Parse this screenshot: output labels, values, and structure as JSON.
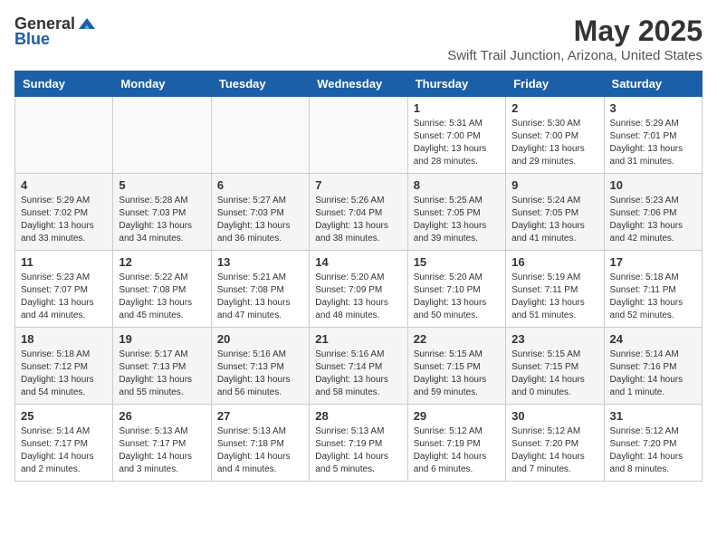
{
  "header": {
    "logo_general": "General",
    "logo_blue": "Blue",
    "month_title": "May 2025",
    "location": "Swift Trail Junction, Arizona, United States"
  },
  "weekdays": [
    "Sunday",
    "Monday",
    "Tuesday",
    "Wednesday",
    "Thursday",
    "Friday",
    "Saturday"
  ],
  "weeks": [
    [
      {
        "day": "",
        "info": ""
      },
      {
        "day": "",
        "info": ""
      },
      {
        "day": "",
        "info": ""
      },
      {
        "day": "",
        "info": ""
      },
      {
        "day": "1",
        "info": "Sunrise: 5:31 AM\nSunset: 7:00 PM\nDaylight: 13 hours\nand 28 minutes."
      },
      {
        "day": "2",
        "info": "Sunrise: 5:30 AM\nSunset: 7:00 PM\nDaylight: 13 hours\nand 29 minutes."
      },
      {
        "day": "3",
        "info": "Sunrise: 5:29 AM\nSunset: 7:01 PM\nDaylight: 13 hours\nand 31 minutes."
      }
    ],
    [
      {
        "day": "4",
        "info": "Sunrise: 5:29 AM\nSunset: 7:02 PM\nDaylight: 13 hours\nand 33 minutes."
      },
      {
        "day": "5",
        "info": "Sunrise: 5:28 AM\nSunset: 7:03 PM\nDaylight: 13 hours\nand 34 minutes."
      },
      {
        "day": "6",
        "info": "Sunrise: 5:27 AM\nSunset: 7:03 PM\nDaylight: 13 hours\nand 36 minutes."
      },
      {
        "day": "7",
        "info": "Sunrise: 5:26 AM\nSunset: 7:04 PM\nDaylight: 13 hours\nand 38 minutes."
      },
      {
        "day": "8",
        "info": "Sunrise: 5:25 AM\nSunset: 7:05 PM\nDaylight: 13 hours\nand 39 minutes."
      },
      {
        "day": "9",
        "info": "Sunrise: 5:24 AM\nSunset: 7:05 PM\nDaylight: 13 hours\nand 41 minutes."
      },
      {
        "day": "10",
        "info": "Sunrise: 5:23 AM\nSunset: 7:06 PM\nDaylight: 13 hours\nand 42 minutes."
      }
    ],
    [
      {
        "day": "11",
        "info": "Sunrise: 5:23 AM\nSunset: 7:07 PM\nDaylight: 13 hours\nand 44 minutes."
      },
      {
        "day": "12",
        "info": "Sunrise: 5:22 AM\nSunset: 7:08 PM\nDaylight: 13 hours\nand 45 minutes."
      },
      {
        "day": "13",
        "info": "Sunrise: 5:21 AM\nSunset: 7:08 PM\nDaylight: 13 hours\nand 47 minutes."
      },
      {
        "day": "14",
        "info": "Sunrise: 5:20 AM\nSunset: 7:09 PM\nDaylight: 13 hours\nand 48 minutes."
      },
      {
        "day": "15",
        "info": "Sunrise: 5:20 AM\nSunset: 7:10 PM\nDaylight: 13 hours\nand 50 minutes."
      },
      {
        "day": "16",
        "info": "Sunrise: 5:19 AM\nSunset: 7:11 PM\nDaylight: 13 hours\nand 51 minutes."
      },
      {
        "day": "17",
        "info": "Sunrise: 5:18 AM\nSunset: 7:11 PM\nDaylight: 13 hours\nand 52 minutes."
      }
    ],
    [
      {
        "day": "18",
        "info": "Sunrise: 5:18 AM\nSunset: 7:12 PM\nDaylight: 13 hours\nand 54 minutes."
      },
      {
        "day": "19",
        "info": "Sunrise: 5:17 AM\nSunset: 7:13 PM\nDaylight: 13 hours\nand 55 minutes."
      },
      {
        "day": "20",
        "info": "Sunrise: 5:16 AM\nSunset: 7:13 PM\nDaylight: 13 hours\nand 56 minutes."
      },
      {
        "day": "21",
        "info": "Sunrise: 5:16 AM\nSunset: 7:14 PM\nDaylight: 13 hours\nand 58 minutes."
      },
      {
        "day": "22",
        "info": "Sunrise: 5:15 AM\nSunset: 7:15 PM\nDaylight: 13 hours\nand 59 minutes."
      },
      {
        "day": "23",
        "info": "Sunrise: 5:15 AM\nSunset: 7:15 PM\nDaylight: 14 hours\nand 0 minutes."
      },
      {
        "day": "24",
        "info": "Sunrise: 5:14 AM\nSunset: 7:16 PM\nDaylight: 14 hours\nand 1 minute."
      }
    ],
    [
      {
        "day": "25",
        "info": "Sunrise: 5:14 AM\nSunset: 7:17 PM\nDaylight: 14 hours\nand 2 minutes."
      },
      {
        "day": "26",
        "info": "Sunrise: 5:13 AM\nSunset: 7:17 PM\nDaylight: 14 hours\nand 3 minutes."
      },
      {
        "day": "27",
        "info": "Sunrise: 5:13 AM\nSunset: 7:18 PM\nDaylight: 14 hours\nand 4 minutes."
      },
      {
        "day": "28",
        "info": "Sunrise: 5:13 AM\nSunset: 7:19 PM\nDaylight: 14 hours\nand 5 minutes."
      },
      {
        "day": "29",
        "info": "Sunrise: 5:12 AM\nSunset: 7:19 PM\nDaylight: 14 hours\nand 6 minutes."
      },
      {
        "day": "30",
        "info": "Sunrise: 5:12 AM\nSunset: 7:20 PM\nDaylight: 14 hours\nand 7 minutes."
      },
      {
        "day": "31",
        "info": "Sunrise: 5:12 AM\nSunset: 7:20 PM\nDaylight: 14 hours\nand 8 minutes."
      }
    ]
  ]
}
